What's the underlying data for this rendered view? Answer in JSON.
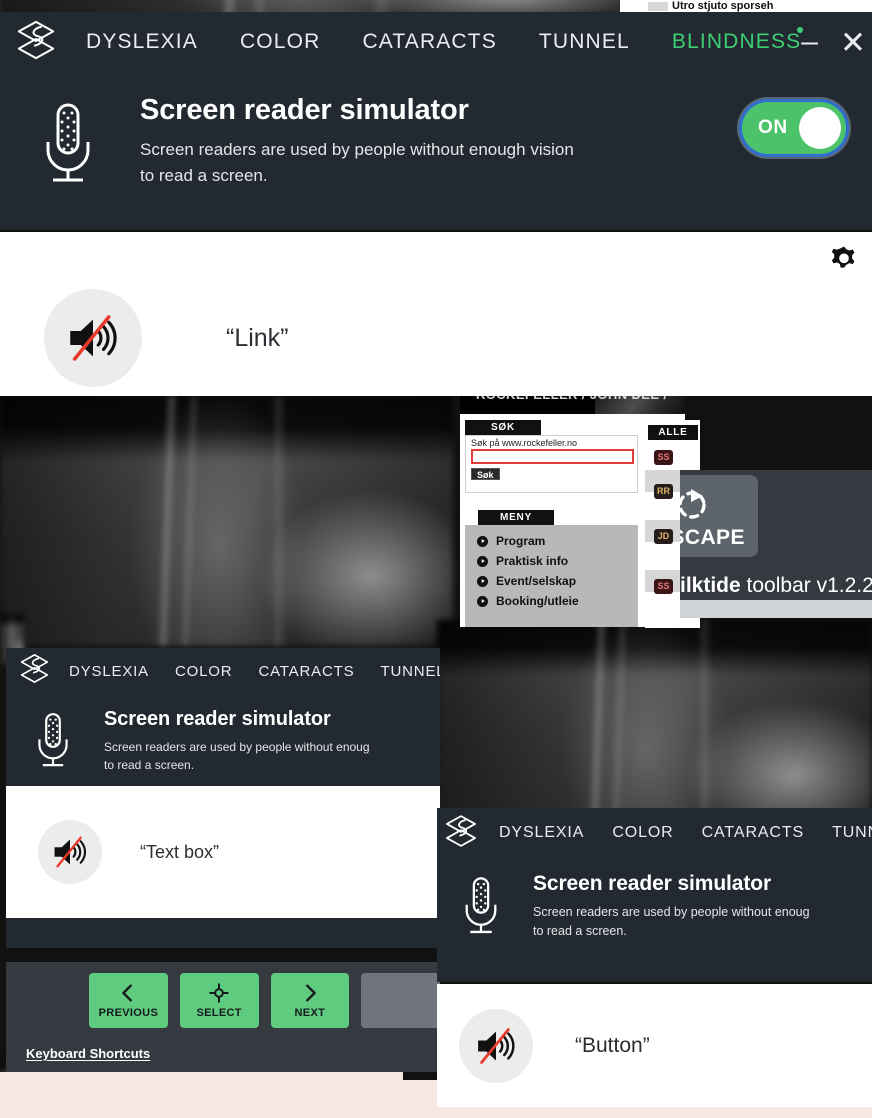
{
  "app": {
    "name": "Silktide toolbar",
    "version_line": "Silktide toolbar v1.2.2",
    "brand_bold": "Silktide",
    "brand_rest": " toolbar v1.2.2",
    "accent_green": "#3ecf74",
    "button_green": "#5fcb7e",
    "toolbar_bg": "#222930",
    "panel_bg": "#343a40"
  },
  "toolbar_primary": {
    "logo_name": "silktide-logo",
    "nav": [
      {
        "label": "DYSLEXIA",
        "active": false
      },
      {
        "label": "COLOR",
        "active": false
      },
      {
        "label": "CATARACTS",
        "active": false
      },
      {
        "label": "TUNNEL",
        "active": false
      },
      {
        "label": "BLINDNESS",
        "active": true
      }
    ],
    "window_buttons": {
      "minimize": "–",
      "close": "✕"
    },
    "simulator": {
      "icon": "microphone-icon",
      "title": "Screen reader simulator",
      "description": "Screen readers are used by people without enough vision to read a screen.",
      "desc_line1": "Screen readers are used by people without enough vision",
      "desc_line2": "to read a screen."
    },
    "toggle": {
      "label": "ON",
      "state": "on"
    }
  },
  "readout_primary": {
    "gear_icon": "gear-icon",
    "speaker_icon": "speaker-muted-icon",
    "announcement": "“Link”"
  },
  "toolbar_secondary": {
    "nav": [
      {
        "label": "DYSLEXIA"
      },
      {
        "label": "COLOR"
      },
      {
        "label": "CATARACTS"
      },
      {
        "label": "TUNNEL"
      }
    ],
    "simulator": {
      "title": "Screen reader simulator",
      "desc_line1": "Screen readers are used by people without enoug",
      "desc_line2": "to read a screen."
    },
    "announcement": "“Text box”",
    "controls": {
      "buttons": [
        {
          "label": "PREVIOUS",
          "icon": "chevron-left-icon"
        },
        {
          "label": "SELECT",
          "icon": "crosshair-icon"
        },
        {
          "label": "NEXT",
          "icon": "chevron-right-icon"
        }
      ],
      "keyboard_shortcuts": "Keyboard Shortcuts"
    }
  },
  "toolbar_tertiary": {
    "nav": [
      {
        "label": "DYSLEXIA"
      },
      {
        "label": "COLOR"
      },
      {
        "label": "CATARACTS"
      },
      {
        "label": "TUNNEL"
      }
    ],
    "simulator": {
      "title": "Screen reader simulator",
      "desc_line1": "Screen readers are used by people without enoug",
      "desc_line2": "to read a screen."
    },
    "announcement": "“Button”"
  },
  "site": {
    "hero_text": "ROCKEFELLER / JOHN DEE /",
    "search": {
      "section_label": "SØK",
      "hint": "Søk på www.rockefeller.no",
      "value": "",
      "submit_label": "Søk"
    },
    "menu": {
      "section_label": "MENY",
      "items": [
        "Program",
        "Praktisk info",
        "Event/selskap",
        "Booking/utleie"
      ]
    },
    "events": {
      "section_label": "ALLE",
      "badges": [
        "SS",
        "RR",
        "JD",
        "SS"
      ]
    }
  },
  "settings_panel": {
    "escape_label": "ESCAPE",
    "spinner_icon": "loading-spinner-icon",
    "version_bold": "Silktide",
    "version_rest": " toolbar v1.2.2"
  }
}
